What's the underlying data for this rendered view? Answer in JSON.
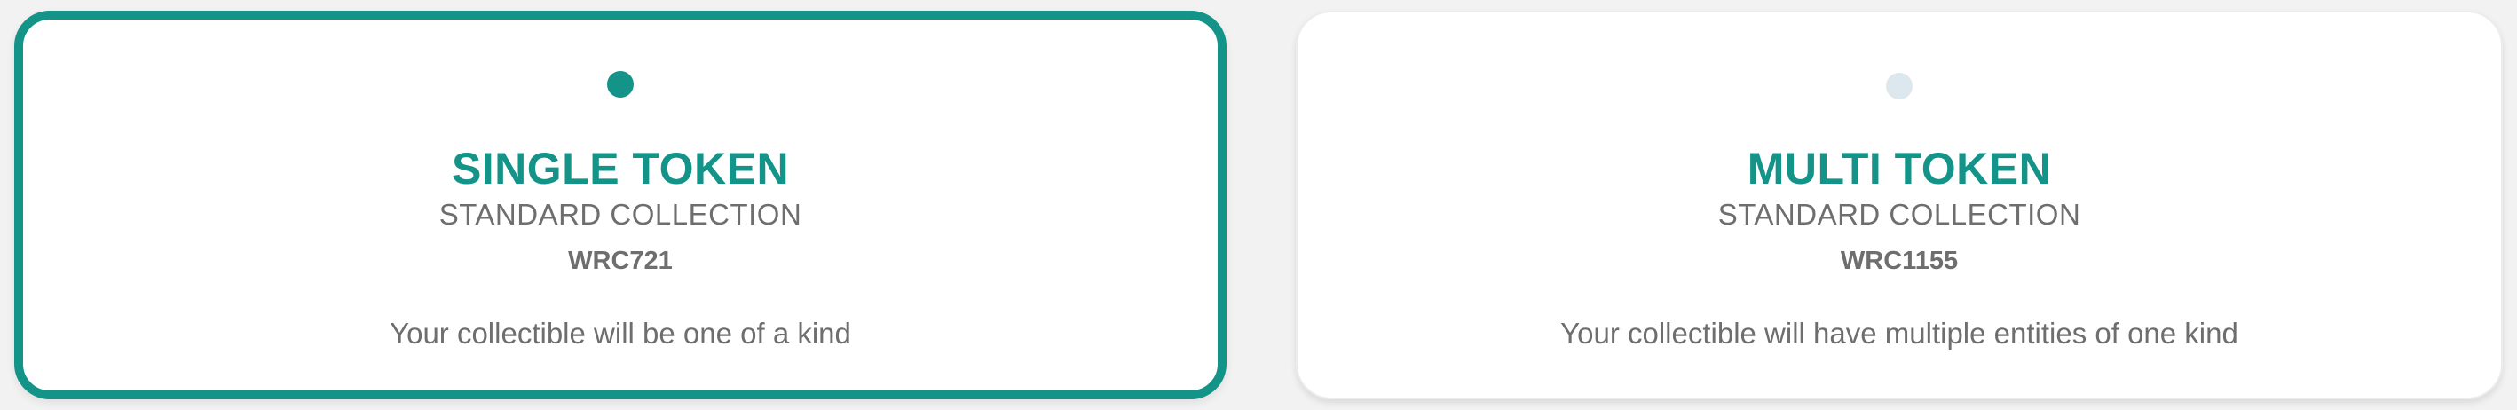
{
  "options": [
    {
      "title": "SINGLE TOKEN",
      "subtitle": "STANDARD COLLECTION",
      "code": "WRC721",
      "description": "Your collectible will be one of a kind",
      "selected": true
    },
    {
      "title": "MULTI TOKEN",
      "subtitle": "STANDARD COLLECTION",
      "code": "WRC1155",
      "description": "Your collectible will have multiple entities of one kind",
      "selected": false
    }
  ],
  "colors": {
    "accent": "#149488",
    "radio_inactive": "#dde8ee",
    "text_muted": "#6e6e6e",
    "card_background": "#ffffff",
    "page_background": "#f2f2f2"
  }
}
